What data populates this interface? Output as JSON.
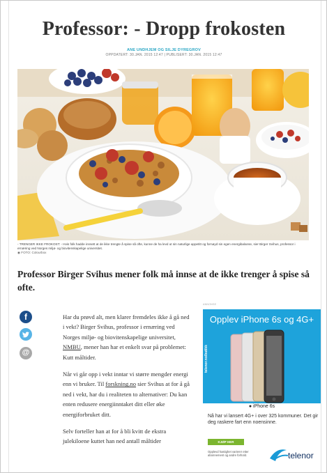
{
  "article": {
    "title": "Professor: - Dropp frokosten",
    "byline": "ANE UNDHJEM OG SILJE DYREGROV",
    "updated": "OPPDATERT: 30.JAN. 2015 12:47 | PUBLISERT: 30.JAN. 2015 12:47",
    "caption": "- TRENGER IKKE FROKOST: - Hvis folk hadde innsett at de ikke trengte å spise så ofte, kunne de ha levd ut sin naturlige appetitt og fornøyd sin egen energibalanse, sier Birger Svihus, professor i ernæring ved Norges miljø- og biovitenskapelige universitet.",
    "photo_credit": "FOTO: Colourbox",
    "lead": "Professor Birger Svihus mener folk må innse at de ikke trenger å spise så ofte.",
    "p1_before": "Har du prøvd alt, men klarer fremdeles ikke å gå ned i vekt? Birger Svihus, professor i ernæring ved Norges miljø- og biovitenskapelige universitet, ",
    "p1_link": "NMBU",
    "p1_after": ", mener han har et enkelt svar på problemet: Kutt måltider.",
    "p2_before": "Når vi går opp i vekt inntar vi større mengder energi enn vi bruker. Til ",
    "p2_link": "forskning.no",
    "p2_after": " sier Svihus at for å gå ned i vekt, har du i realiteten to alternativer: Du kan enten redusere energiinntaket ditt eller øke energiforbruket ditt.",
    "p3": "Selv forteller han at for å bli kvitt de ekstra julekiloene kuttet han ned antall måltider"
  },
  "share": {
    "facebook_icon": "f",
    "twitter_icon": "t",
    "email_icon": "@"
  },
  "ad": {
    "label": "ANNONSE",
    "headline": "Opplev iPhone 6s og 4G+",
    "side_text": "telenor.no/butikk",
    "model": "iPhone 6s",
    "copy": "Nå har vi lansert 4G+ i over 325 kommuner. Det gir deg raskere fart enn noensinne.",
    "button": "KJØP HER",
    "small_print": "Opplevd hastighet varierer etter abonnement og andre forhold.",
    "logo": "telenor",
    "colors": {
      "background": "#1ea3db",
      "button": "#7bb52f"
    }
  }
}
